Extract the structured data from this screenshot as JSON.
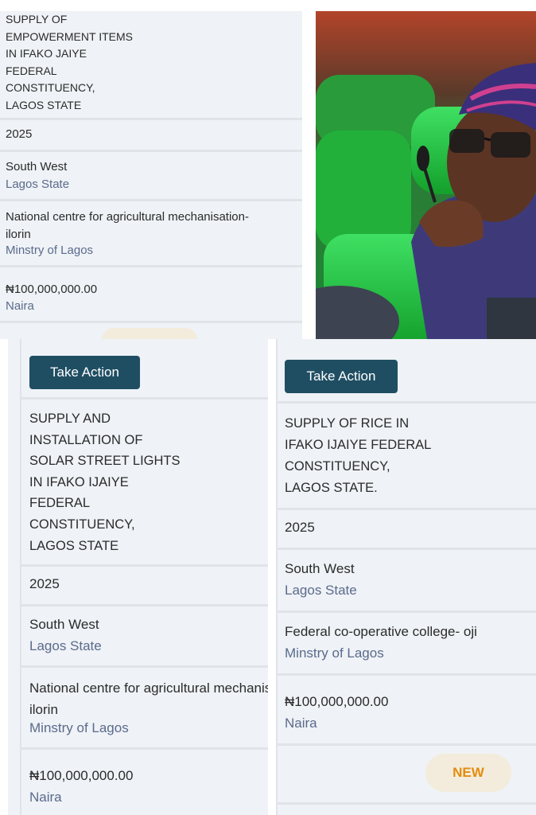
{
  "panel_top_left": {
    "title": "SUPPLY OF\nEMPOWERMENT ITEMS\nIN IFAKO JAIYE\nFEDERAL\nCONSTITUENCY,\nLAGOS STATE",
    "year": "2025",
    "region": "South West",
    "state": "Lagos State",
    "agency": "National centre for agricultural mechanisation-\nilorin",
    "ministry": "Minstry of Lagos",
    "amount": "₦100,000,000.00",
    "currency": "Naira"
  },
  "panel_bottom_left": {
    "action_label": "Take Action",
    "title": "SUPPLY AND\nINSTALLATION OF\nSOLAR STREET LIGHTS\nIN IFAKO IJAIYE\nFEDERAL\nCONSTITUENCY,\nLAGOS STATE",
    "year": "2025",
    "region": "South West",
    "state": "Lagos State",
    "agency": "National centre for agricultural mechanisation-\nilorin",
    "ministry": "Minstry of Lagos",
    "amount": "₦100,000,000.00",
    "currency": "Naira"
  },
  "panel_bottom_right": {
    "action_label": "Take Action",
    "title": "SUPPLY OF RICE IN\nIFAKO IJAIYE FEDERAL\nCONSTITUENCY,\nLAGOS STATE.",
    "year": "2025",
    "region": "South West",
    "state": "Lagos State",
    "agency": "Federal co-operative college- oji",
    "ministry": "Minstry of Lagos",
    "amount": "₦100,000,000.00",
    "currency": "Naira",
    "badge": "NEW"
  },
  "colors": {
    "button": "#1f4e63",
    "panel_bg": "#eff2f6",
    "secondary_text": "#5a6b8c",
    "badge_text": "#e38c0e",
    "seat_green": "#1fbf3a"
  }
}
